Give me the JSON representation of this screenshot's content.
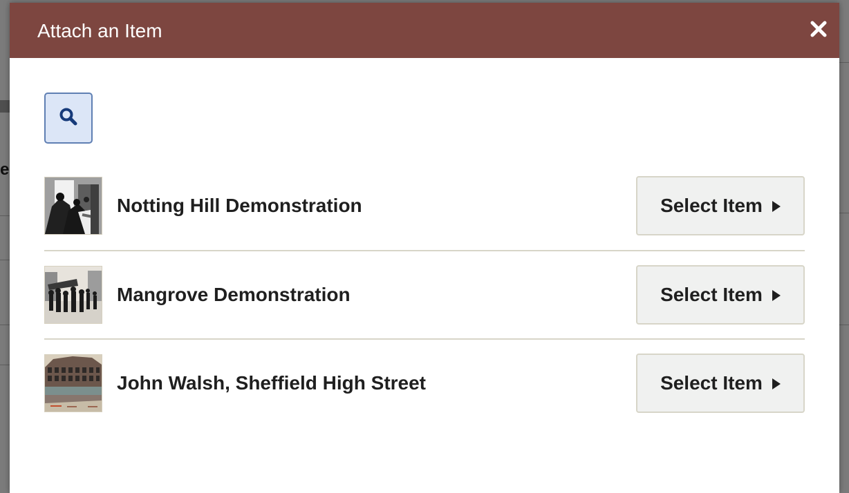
{
  "modal": {
    "title": "Attach an Item",
    "close_icon": "close-icon",
    "search_icon": "search-icon"
  },
  "background": {
    "partial_text": "er"
  },
  "items": [
    {
      "title": "Notting Hill Demonstration",
      "thumb_icon": "photo-thumbnail-icon",
      "button_label": "Select Item"
    },
    {
      "title": "Mangrove Demonstration",
      "thumb_icon": "photo-thumbnail-icon",
      "button_label": "Select Item"
    },
    {
      "title": "John Walsh, Sheffield High Street",
      "thumb_icon": "photo-thumbnail-icon",
      "button_label": "Select Item"
    }
  ],
  "colors": {
    "header_bg": "#7d4640",
    "search_bg": "#dce6f7",
    "search_border": "#5f7fb3",
    "button_bg": "#f0f1f0",
    "row_divider": "#d7d5c8"
  }
}
